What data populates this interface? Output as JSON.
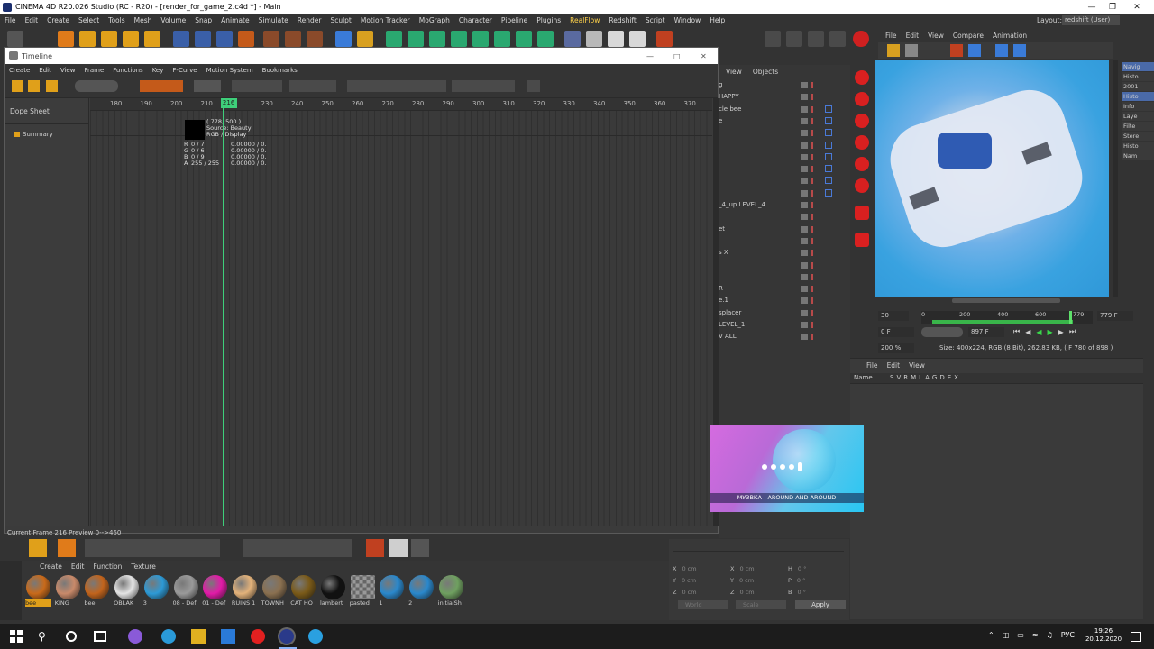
{
  "window": {
    "title": "CINEMA 4D R20.026 Studio (RC - R20) - [render_for_game_2.c4d *] - Main",
    "layout_label": "Layout:",
    "layout_value": "redshift (User)"
  },
  "menu": [
    "File",
    "Edit",
    "Create",
    "Select",
    "Tools",
    "Mesh",
    "Volume",
    "Snap",
    "Animate",
    "Simulate",
    "Render",
    "Sculpt",
    "Motion Tracker",
    "MoGraph",
    "Character",
    "Pipeline",
    "Plugins",
    "RealFlow",
    "Redshift",
    "Script",
    "Window",
    "Help"
  ],
  "timeline": {
    "title": "Timeline",
    "menu": [
      "Create",
      "Edit",
      "View",
      "Frame",
      "Functions",
      "Key",
      "F-Curve",
      "Motion System",
      "Bookmarks"
    ],
    "dope_sheet": "Dope Sheet",
    "summary": "Summary",
    "ruler": [
      "180",
      "190",
      "200",
      "210",
      "216",
      "230",
      "240",
      "250",
      "260",
      "270",
      "280",
      "290",
      "300",
      "310",
      "320",
      "330",
      "340",
      "350",
      "360",
      "370"
    ],
    "playhead_frame": 216,
    "status": "Current Frame  216  Preview  0-->460"
  },
  "pixel_info": {
    "coord": "( 778, 500 )",
    "source": "Source: Beauty",
    "display": "RGB / Display",
    "rows": [
      {
        "ch": "R",
        "v1": "0 / 7",
        "v2": "0.00000 / 0."
      },
      {
        "ch": "G",
        "v1": "0 / 6",
        "v2": "0.00000 / 0."
      },
      {
        "ch": "B",
        "v1": "0 / 9",
        "v2": "0.00000 / 0."
      },
      {
        "ch": "A",
        "v1": "255 / 255",
        "v2": "0.00000 / 0."
      }
    ]
  },
  "objects": {
    "header": [
      "View",
      "Objects"
    ],
    "rows": [
      "g",
      "HAPPY",
      "cle bee",
      "e",
      "",
      "",
      "",
      "",
      "",
      "",
      "_4_up LEVEL_4",
      "",
      "et",
      "",
      "s X",
      "",
      "",
      "R",
      "e.1",
      "splacer",
      "LEVEL_1",
      "V ALL"
    ]
  },
  "picture_viewer": {
    "menu": [
      "File",
      "Edit",
      "View",
      "Compare",
      "Animation"
    ],
    "right_tabs": [
      "Navig",
      "Histo",
      "2001",
      "Histo",
      "Info",
      "Laye",
      "Filte",
      "Stere",
      "Histo",
      "Nam"
    ],
    "fps": "30",
    "frame_ticks": [
      "0",
      "200",
      "400",
      "600",
      "779"
    ],
    "end_frame": "779 F",
    "cur_frame": "0 F",
    "range_end": "897 F",
    "zoom": "200 %",
    "size_info": "Size: 400x224, RGB (8 Bit), 262.83 KB,  ( F 780 of 898 )"
  },
  "layers": {
    "menu": [
      "File",
      "Edit",
      "View"
    ],
    "header": "Name",
    "cols": [
      "S",
      "V",
      "R",
      "M",
      "L",
      "A",
      "G",
      "D",
      "E",
      "X"
    ]
  },
  "coords": {
    "rows": [
      {
        "a": "X",
        "av": "0 cm",
        "b": "X",
        "bv": "0 cm",
        "c": "H",
        "cv": "0 °"
      },
      {
        "a": "Y",
        "av": "0 cm",
        "b": "Y",
        "bv": "0 cm",
        "c": "P",
        "cv": "0 °"
      },
      {
        "a": "Z",
        "av": "0 cm",
        "b": "Z",
        "bv": "0 cm",
        "c": "B",
        "cv": "0 °"
      }
    ],
    "world": "World",
    "scale": "Scale",
    "apply": "Apply"
  },
  "materials": {
    "menu": [
      "Create",
      "Edit",
      "Function",
      "Texture"
    ],
    "items": [
      {
        "label": "bee",
        "color": "#c96a1a"
      },
      {
        "label": "KING",
        "color": "#c98a6a"
      },
      {
        "label": "bee",
        "color": "#c2641c"
      },
      {
        "label": "OBLAK",
        "color": "#e4e4e4"
      },
      {
        "label": "3",
        "color": "#2d9ad6"
      },
      {
        "label": "08 - Def",
        "color": "#9a9a9a"
      },
      {
        "label": "01 - Def",
        "color": "#e21aa8"
      },
      {
        "label": "RUINS 1",
        "color": "#e3b27a"
      },
      {
        "label": "TOWNH",
        "color": "#8a7050"
      },
      {
        "label": "CAT HO",
        "color": "#7a5a18"
      },
      {
        "label": "lambert",
        "color": "#111111"
      },
      {
        "label": "pasted",
        "color": "#8c8c8c"
      },
      {
        "label": "1",
        "color": "#2a88cc"
      },
      {
        "label": "2",
        "color": "#2a88cc"
      },
      {
        "label": "initialSh",
        "color": "#6fa060"
      }
    ]
  },
  "video": {
    "caption": "МУЗВКА - AROUND AND AROUND"
  },
  "taskbar": {
    "lang": "РУС",
    "time": "19:26",
    "date": "20.12.2020"
  }
}
